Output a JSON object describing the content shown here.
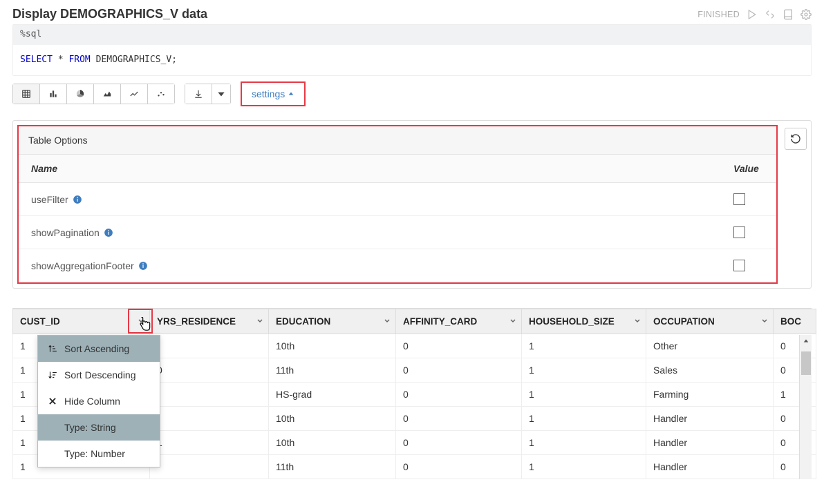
{
  "header": {
    "title": "Display DEMOGRAPHICS_V data",
    "status": "FINISHED"
  },
  "code": {
    "magic": "%sql",
    "sql_kw1": "SELECT",
    "sql_star": " * ",
    "sql_kw2": "FROM",
    "sql_table": " DEMOGRAPHICS_V;"
  },
  "toolbar": {
    "settings_label": "settings"
  },
  "options": {
    "panel_title": "Table Options",
    "header_name": "Name",
    "header_value": "Value",
    "rows": [
      {
        "name": "useFilter"
      },
      {
        "name": "showPagination"
      },
      {
        "name": "showAggregationFooter"
      }
    ]
  },
  "columns": {
    "c0": "CUST_ID",
    "c1": "YRS_RESIDENCE",
    "c2": "EDUCATION",
    "c3": "AFFINITY_CARD",
    "c4": "HOUSEHOLD_SIZE",
    "c5": "OCCUPATION",
    "c6": "BOC"
  },
  "rows": [
    {
      "cust": "1",
      "yrs": ")",
      "edu": "10th",
      "aff": "0",
      "hh": "1",
      "occ": "Other",
      "boc": "0"
    },
    {
      "cust": "1",
      "yrs": "0",
      "edu": "11th",
      "aff": "0",
      "hh": "1",
      "occ": "Sales",
      "boc": "0"
    },
    {
      "cust": "1",
      "yrs": "",
      "edu": "HS-grad",
      "aff": "0",
      "hh": "1",
      "occ": "Farming",
      "boc": "1"
    },
    {
      "cust": "1",
      "yrs": "",
      "edu": "10th",
      "aff": "0",
      "hh": "1",
      "occ": "Handler",
      "boc": "0"
    },
    {
      "cust": "1",
      "yrs": "1",
      "edu": "10th",
      "aff": "0",
      "hh": "1",
      "occ": "Handler",
      "boc": "0"
    },
    {
      "cust": "1",
      "yrs": "",
      "edu": "11th",
      "aff": "0",
      "hh": "1",
      "occ": "Handler",
      "boc": "0"
    }
  ],
  "col_menu": {
    "sort_asc": "Sort Ascending",
    "sort_desc": "Sort Descending",
    "hide": "Hide Column",
    "type_str": "Type: String",
    "type_num": "Type: Number"
  }
}
